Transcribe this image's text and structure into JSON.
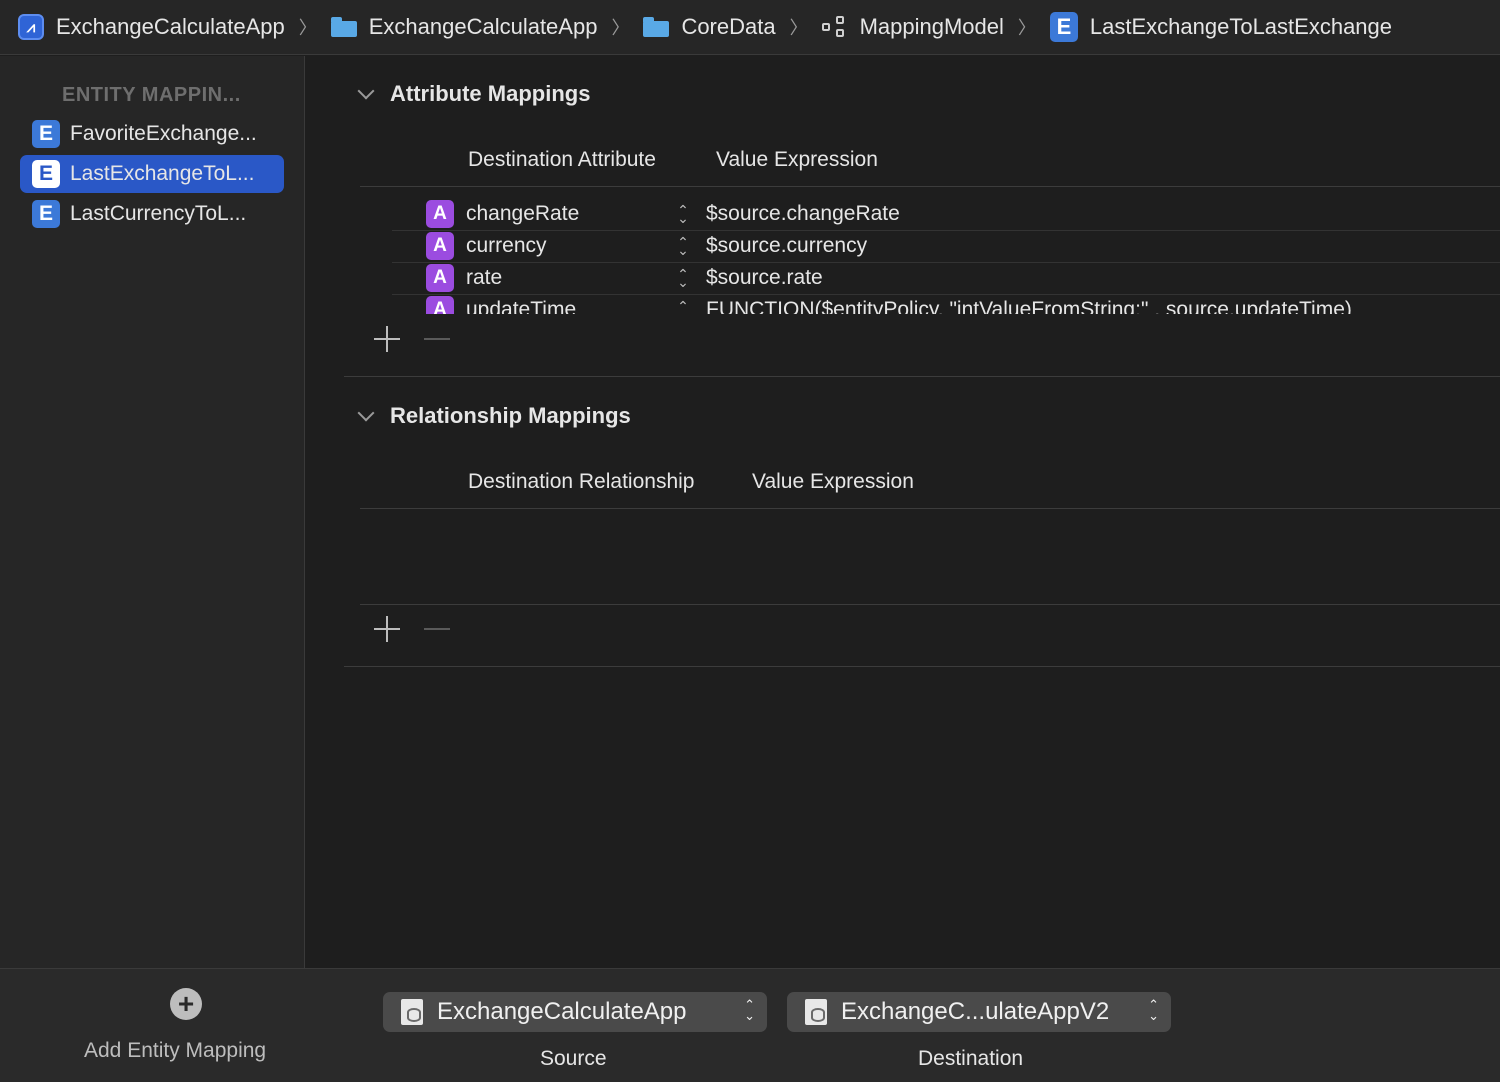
{
  "breadcrumb": {
    "items": [
      "ExchangeCalculateApp",
      "ExchangeCalculateApp",
      "CoreData",
      "MappingModel",
      "LastExchangeToLastExchange"
    ],
    "separator": "〉"
  },
  "sidebar": {
    "header": "ENTITY MAPPIN...",
    "entity_badge": "E",
    "items": [
      {
        "label": "FavoriteExchange..."
      },
      {
        "label": "LastExchangeToL..."
      },
      {
        "label": "LastCurrencyToL..."
      }
    ]
  },
  "attribute_mappings": {
    "title": "Attribute Mappings",
    "col_destination": "Destination Attribute",
    "col_value": "Value Expression",
    "attr_badge": "A",
    "rows": [
      {
        "attribute": "changeRate",
        "expression": "$source.changeRate"
      },
      {
        "attribute": "currency",
        "expression": "$source.currency"
      },
      {
        "attribute": "rate",
        "expression": "$source.rate"
      },
      {
        "attribute": "updateTime",
        "expression": "FUNCTION($entityPolicy, \"intValueFromString:\" , source.updateTime)"
      }
    ]
  },
  "relationship_mappings": {
    "title": "Relationship Mappings",
    "col_destination": "Destination Relationship",
    "col_value": "Value Expression",
    "rows": []
  },
  "bottom": {
    "add_entity_mapping_label": "Add Entity Mapping",
    "source_value": "ExchangeCalculateApp",
    "source_label": "Source",
    "destination_value": "ExchangeC...ulateAppV2",
    "destination_label": "Destination"
  },
  "colors": {
    "selection": "#2a58c7",
    "entity_icon": "#3c79d8",
    "attribute_icon": "#9b4ce0",
    "folder_icon": "#59a9e6"
  }
}
